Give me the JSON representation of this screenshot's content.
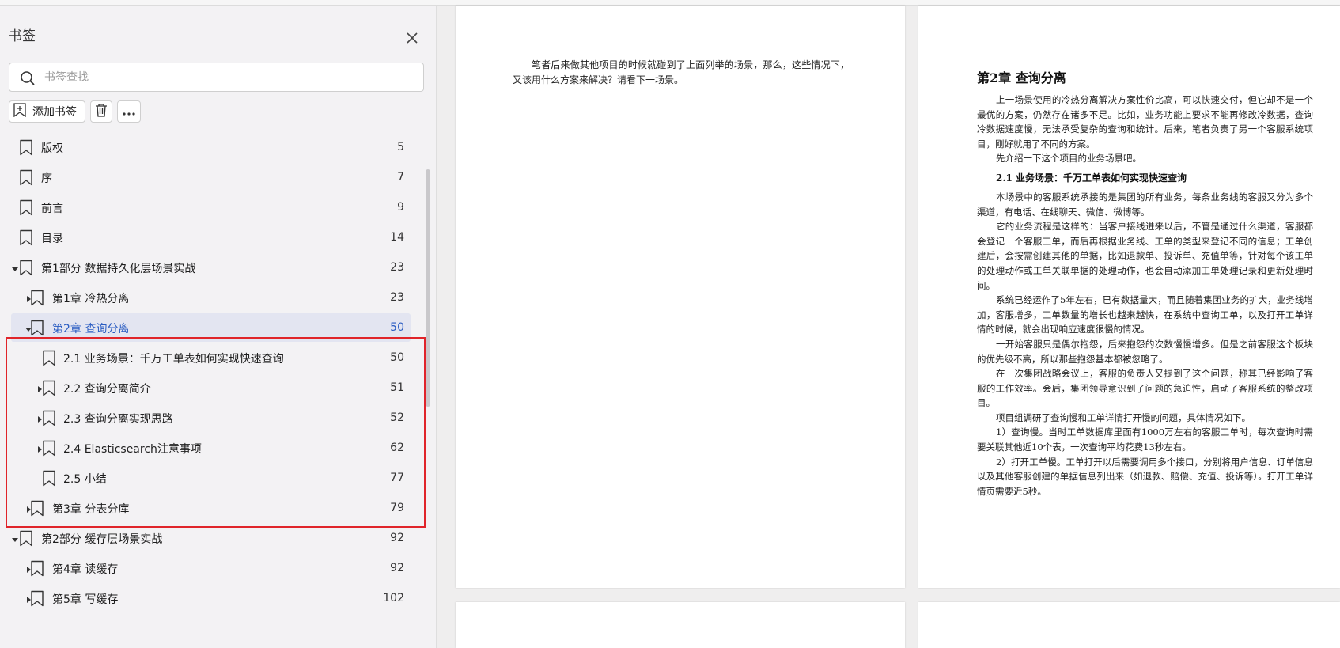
{
  "sidebar": {
    "title": "书签",
    "search_placeholder": "书签查找",
    "add_label": "添加书签",
    "items": [
      {
        "label": "版权",
        "page": "5",
        "level": 0,
        "caret": "none"
      },
      {
        "label": "序",
        "page": "7",
        "level": 0,
        "caret": "none"
      },
      {
        "label": "前言",
        "page": "9",
        "level": 0,
        "caret": "none"
      },
      {
        "label": "目录",
        "page": "14",
        "level": 0,
        "caret": "none"
      },
      {
        "label": "第1部分 数据持久化层场景实战",
        "page": "23",
        "level": 0,
        "caret": "down"
      },
      {
        "label": "第1章 冷热分离",
        "page": "23",
        "level": 1,
        "caret": "right"
      },
      {
        "label": "第2章 查询分离",
        "page": "50",
        "level": 1,
        "caret": "down",
        "selected": true
      },
      {
        "label": "2.1 业务场景：千万工单表如何实现快速查询",
        "page": "50",
        "level": 2,
        "caret": "none"
      },
      {
        "label": "2.2 查询分离简介",
        "page": "51",
        "level": 2,
        "caret": "right"
      },
      {
        "label": "2.3 查询分离实现思路",
        "page": "52",
        "level": 2,
        "caret": "right"
      },
      {
        "label": "2.4 Elasticsearch注意事项",
        "page": "62",
        "level": 2,
        "caret": "right"
      },
      {
        "label": "2.5 小结",
        "page": "77",
        "level": 2,
        "caret": "none"
      },
      {
        "label": "第3章 分表分库",
        "page": "79",
        "level": 1,
        "caret": "right"
      },
      {
        "label": "第2部分 缓存层场景实战",
        "page": "92",
        "level": 0,
        "caret": "down"
      },
      {
        "label": "第4章 读缓存",
        "page": "92",
        "level": 1,
        "caret": "right"
      },
      {
        "label": "第5章 写缓存",
        "page": "102",
        "level": 1,
        "caret": "right"
      }
    ]
  },
  "document": {
    "page1_text": "笔者后来做其他项目的时候就碰到了上面列举的场景，那么，这些情况下，又该用什么方案来解决？请看下一场景。",
    "page2": {
      "chapter_title": "第2章  查询分离",
      "para1": "上一场景使用的冷热分离解决方案性价比高，可以快速交付，但它却不是一个最优的方案，仍然存在诸多不足。比如，业务功能上要求不能再修改冷数据，查询冷数据速度慢，无法承受复杂的查询和统计。后来，笔者负责了另一个客服系统项目，刚好就用了不同的方案。",
      "para2": "先介绍一下这个项目的业务场景吧。",
      "section_title": "2.1  业务场景：千万工单表如何实现快速查询",
      "para3": "本场景中的客服系统承接的是集团的所有业务，每条业务线的客服又分为多个渠道，有电话、在线聊天、微信、微博等。",
      "para4": "它的业务流程是这样的：当客户接线进来以后，不管是通过什么渠道，客服都会登记一个客服工单，而后再根据业务线、工单的类型来登记不同的信息；工单创建后，会按需创建其他的单据，比如退款单、投诉单、充值单等，针对每个该工单的处理动作或工单关联单据的处理动作，也会自动添加工单处理记录和更新处理时间。",
      "para5": "系统已经运作了5年左右，已有数据量大，而且随着集团业务的扩大，业务线增加，客服增多，工单数量的增长也越来越快，在系统中查询工单，以及打开工单详情的时候，就会出现响应速度很慢的情况。",
      "para6": "一开始客服只是偶尔抱怨，后来抱怨的次数慢慢增多。但是之前客服这个板块的优先级不高，所以那些抱怨基本都被忽略了。",
      "para7": "在一次集团战略会议上，客服的负责人又提到了这个问题，称其已经影响了客服的工作效率。会后，集团领导意识到了问题的急迫性，启动了客服系统的整改项目。",
      "para8": "项目组调研了查询慢和工单详情打开慢的问题，具体情况如下。",
      "para9": "1）查询慢。当时工单数据库里面有1000万左右的客服工单时，每次查询时需要关联其他近10个表，一次查询平均花费13秒左右。",
      "para10": "2）打开工单慢。工单打开以后需要调用多个接口，分别将用户信息、订单信息以及其他客服创建的单据信息列出来（如退款、赔偿、充值、投诉等）。打开工单详情页需要近5秒。"
    }
  },
  "colors": {
    "selected_text": "#2a5cc2",
    "selected_bg": "#e3e5f1",
    "highlight_box": "#e0242a"
  }
}
